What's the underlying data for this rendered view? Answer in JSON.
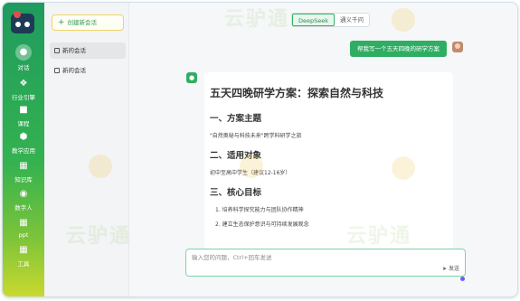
{
  "app": {
    "logo": "app-logo"
  },
  "rail": {
    "items": [
      {
        "label": "对话",
        "icon": "chat-icon",
        "active": true
      },
      {
        "label": "行业引擎",
        "icon": "engine-icon"
      },
      {
        "label": "课程",
        "icon": "course-icon"
      },
      {
        "label": "教学应用",
        "icon": "app-icon"
      },
      {
        "label": "知识库",
        "icon": "knowledge-icon"
      },
      {
        "label": "数字人",
        "icon": "digital-human-icon"
      },
      {
        "label": "ppt",
        "icon": "ppt-icon"
      },
      {
        "label": "工具",
        "icon": "tools-icon"
      }
    ]
  },
  "sidebar": {
    "new_chat_label": "创建新会话",
    "conversations": [
      {
        "label": "新的会话"
      },
      {
        "label": "新的会话"
      }
    ]
  },
  "model_tabs": [
    {
      "label": "DeepSeek",
      "active": true
    },
    {
      "label": "通义千问"
    }
  ],
  "chat": {
    "user_message": "帮我写一个五天四晚的研学方案",
    "answer": {
      "title": "五天四晚研学方案：探索自然与科技",
      "sections": [
        {
          "heading": "一、方案主题",
          "text": "\"自然奥秘与科技未来\"跨学科研学之旅"
        },
        {
          "heading": "二、适用对象",
          "text": "初中至高中学生（建议12-16岁）"
        },
        {
          "heading": "三、核心目标",
          "items": [
            "1. 培养科学探究能力与团队协作精神",
            "2. 建立生态保护意识与可持续发展观念"
          ]
        }
      ]
    }
  },
  "input": {
    "placeholder": "输入您的问题，Ctrl+回车发送",
    "send_label": "发送"
  },
  "watermark": {
    "text": "云驴通"
  },
  "colors": {
    "accent": "#2fae63",
    "rail_top": "#1e9b5e",
    "rail_bottom": "#c9d92e"
  }
}
